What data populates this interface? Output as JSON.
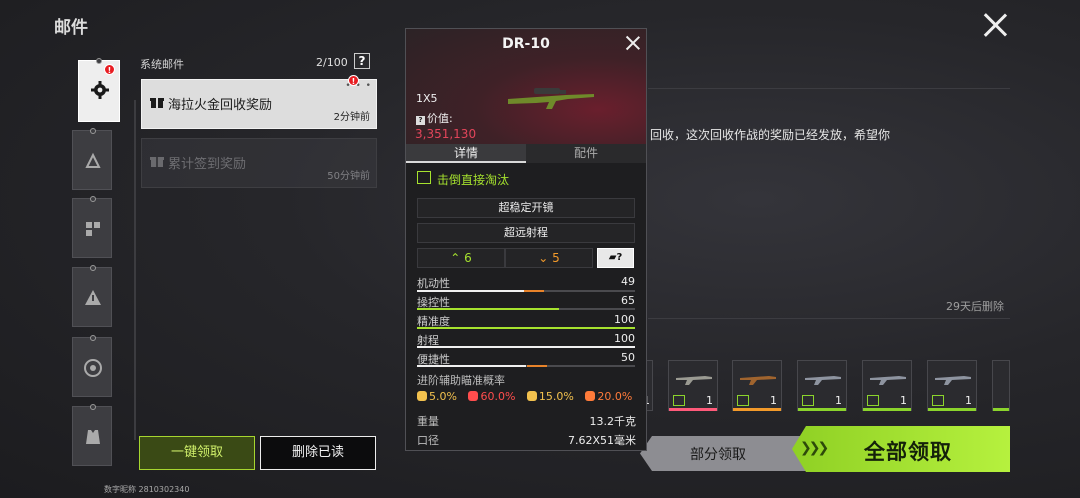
{
  "header": {
    "title": "邮件"
  },
  "mail_list": {
    "category_label": "系统邮件",
    "count": "2/100",
    "help": "?",
    "items": [
      {
        "title": "海拉火金回收奖励",
        "time": "2分钟前"
      },
      {
        "title": "累计签到奖励",
        "time": "50分钟前"
      }
    ],
    "claim_one_label": "一键领取",
    "delete_read_label": "删除已读"
  },
  "player_id": "数字昵称  2810302340",
  "mail_content": {
    "body_visible": "回收，这次回收作战的奖励已经发放，希望你",
    "expire": "29天后删除",
    "attachments": [
      {
        "name": "rifle-1",
        "qty": "1",
        "bar_color": "#ff5a7a"
      },
      {
        "name": "rifle-2",
        "qty": "1",
        "bar_color": "#f39a2a"
      },
      {
        "name": "rifle-3",
        "qty": "1",
        "bar_color": "#8bd42c"
      },
      {
        "name": "rifle-4",
        "qty": "1",
        "bar_color": "#8bd42c"
      },
      {
        "name": "rifle-5",
        "qty": "1",
        "bar_color": "#8bd42c"
      }
    ],
    "partial_claim_label": "部分领取",
    "claim_all_label": "全部领取"
  },
  "item_popup": {
    "name": "DR-10",
    "qty": "1X5",
    "value_label": "价值:",
    "value": "3,351,130",
    "tabs": [
      "详情",
      "配件"
    ],
    "knockdown": "击倒直接淘汰",
    "traits": [
      "超稳定开镜",
      "超远射程"
    ],
    "buff_count": "6",
    "debuff_count": "5",
    "stats": [
      {
        "label": "机动性",
        "value": "49"
      },
      {
        "label": "操控性",
        "value": "65"
      },
      {
        "label": "精准度",
        "value": "100"
      },
      {
        "label": "射程",
        "value": "100"
      },
      {
        "label": "便捷性",
        "value": "50"
      }
    ],
    "aim_assist_title": "进阶辅助瞄准概率",
    "aim_assist": [
      "5.0%",
      "60.0%",
      "15.0%",
      "20.0%"
    ],
    "weight_label": "重量",
    "weight": "13.2千克",
    "caliber_label": "口径",
    "caliber": "7.62X51毫米"
  },
  "colors": {
    "accent_green": "#a6e22e",
    "value_red": "#e2455a",
    "debuff_orange": "#f39a2a"
  }
}
